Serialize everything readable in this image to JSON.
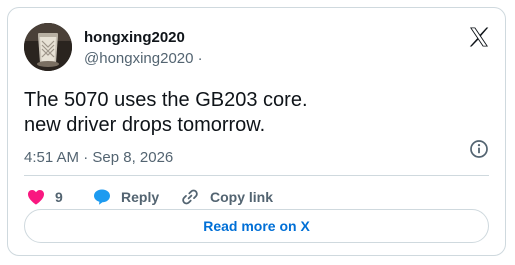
{
  "author": {
    "display_name": "hongxing2020",
    "handle": "@hongxing2020 ·"
  },
  "tweet": {
    "lines": [
      "The 5070 uses the GB203 core.",
      "new driver drops tomorrow."
    ],
    "timestamp": "4:51 AM · Sep 8, 2026"
  },
  "actions": {
    "like_count": "9",
    "reply_label": "Reply",
    "copy_label": "Copy link"
  },
  "read_more_label": "Read more on X",
  "icons": {
    "logo": "x-logo-icon",
    "info": "info-icon",
    "like": "heart-icon",
    "reply": "speech-bubble-icon",
    "copy": "link-icon"
  },
  "colors": {
    "like": "#f91880",
    "reply": "#1d9bf0",
    "link_text": "#006fd6",
    "muted_text": "#536471",
    "border": "#cfd9de"
  }
}
